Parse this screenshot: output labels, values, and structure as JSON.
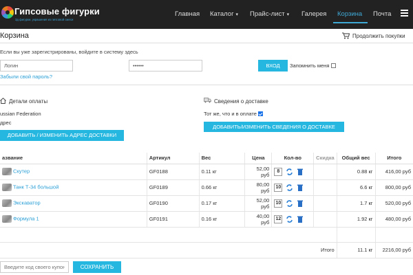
{
  "header": {
    "brand": "Гипсовые фигурки",
    "tagline": "3д фигурки, украшения из гипсовой смеси",
    "nav": [
      {
        "label": "Главная",
        "dropdown": false,
        "active": false
      },
      {
        "label": "Каталог",
        "dropdown": true,
        "active": false
      },
      {
        "label": "Прайс-лист",
        "dropdown": true,
        "active": false
      },
      {
        "label": "Галерея",
        "dropdown": false,
        "active": false
      },
      {
        "label": "Корзина",
        "dropdown": false,
        "active": true
      },
      {
        "label": "Почта",
        "dropdown": false,
        "active": false
      }
    ],
    "menu_icon": "hamburger-icon"
  },
  "page": {
    "title": "Корзина",
    "continue_shopping": "Продолжить покупки"
  },
  "login": {
    "hint": "Если вы уже зарегистрированы, войдите в систему здесь",
    "username_value": "Логин",
    "password_value": "••••••",
    "login_button": "ВХОД",
    "remember_label": "Запомнить меня",
    "forgot_link": "Забыли свой пароль?"
  },
  "billing": {
    "heading": "Детали оплаты",
    "country": "ussian Federation",
    "address_label": "дрес",
    "button": "ДОБАВИТЬ / ИЗМЕНИТЬ АДРЕС ДОСТАВКИ"
  },
  "shipping": {
    "heading": "Сведения о доставке",
    "same_label": "Тот же, что и в оплате",
    "button": "ДОБАВИТЬ/ИЗМЕНИТЬ СВЕДЕНИЯ О ДОСТАВКЕ"
  },
  "table": {
    "headers": {
      "name": "азвание",
      "sku": "Артикул",
      "weight": "Вес",
      "price": "Цена",
      "qty": "Кол-во",
      "discount": "Скидка",
      "total_weight": "Общий вес",
      "total": "Итого"
    },
    "rows": [
      {
        "name": "Скутер",
        "sku": "GF0188",
        "weight": "0.11 кг",
        "price": "52,00 руб",
        "qty": "8",
        "total_weight": "0.88 кг",
        "total": "416,00 руб"
      },
      {
        "name": "Танк Т-34 большой",
        "sku": "GF0189",
        "weight": "0.66 кг",
        "price": "80,00 руб",
        "qty": "10",
        "total_weight": "6.6 кг",
        "total": "800,00 руб"
      },
      {
        "name": "Экскаватор",
        "sku": "GF0190",
        "weight": "0.17 кг",
        "price": "52,00 руб",
        "qty": "10",
        "total_weight": "1.7 кг",
        "total": "520,00 руб"
      },
      {
        "name": "Формула 1",
        "sku": "GF0191",
        "weight": "0.16 кг",
        "price": "40,00 руб",
        "qty": "12",
        "total_weight": "1.92 кг",
        "total": "480,00 руб"
      }
    ],
    "summary_label": "Итого",
    "summary_weight": "11.1 кг",
    "summary_total": "2216,00 руб"
  },
  "coupon": {
    "placeholder": "Введите код своего купона",
    "save_button": "СОХРАНИТЬ"
  },
  "colors": {
    "header_bg": "#222222",
    "accent": "#25b7e0",
    "link": "#2a9fd6"
  }
}
